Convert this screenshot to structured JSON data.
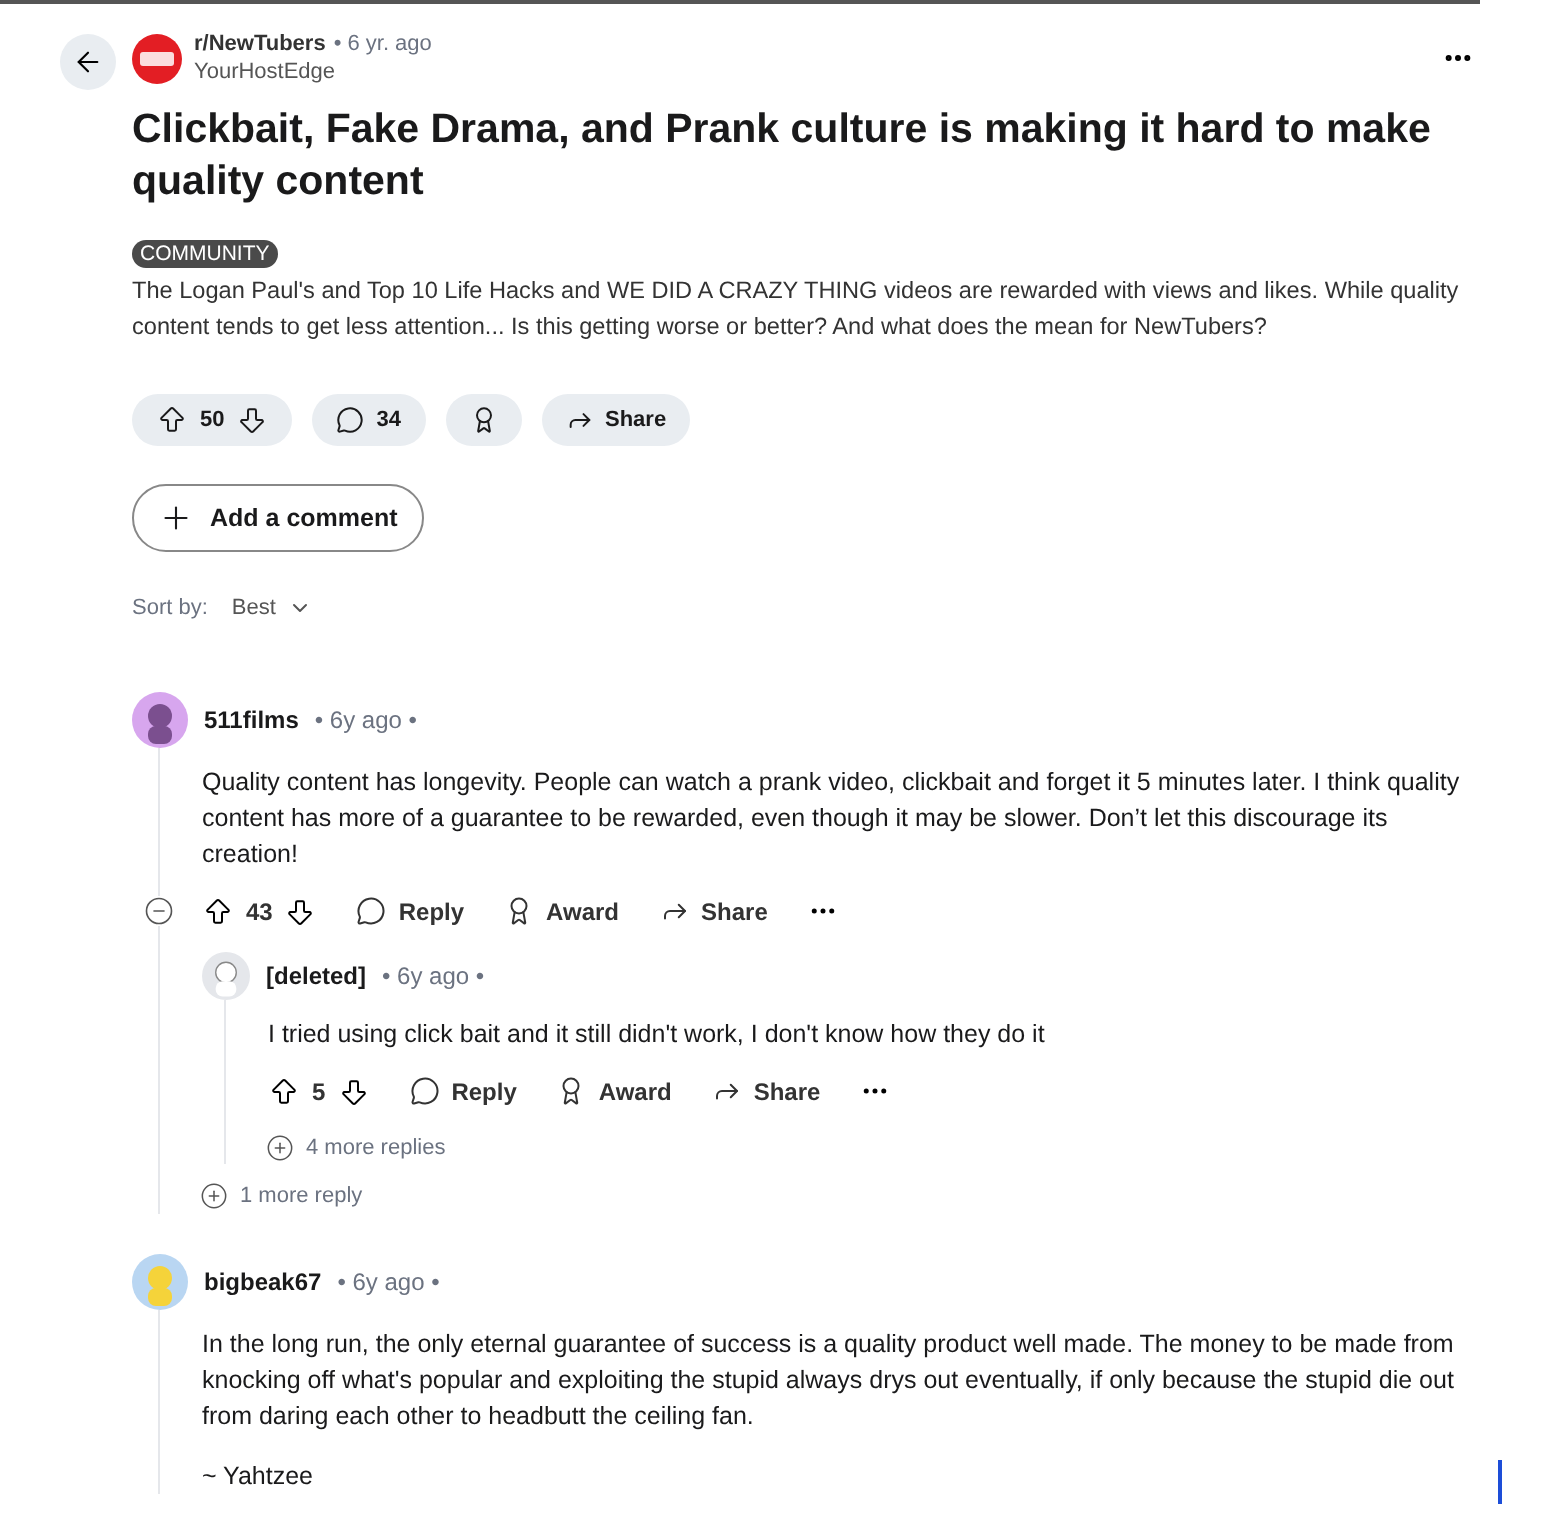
{
  "post": {
    "subreddit": "r/NewTubers",
    "age": "• 6 yr. ago",
    "author": "YourHostEdge",
    "title": "Clickbait, Fake Drama, and Prank culture is making it hard to make quality content",
    "flair": "COMMUNITY",
    "body": "The Logan Paul's and Top 10 Life Hacks and WE DID A CRAZY THING videos are rewarded with views and likes. While quality content tends to get less attention... Is this getting worse or better? And what does the mean for NewTubers?",
    "votes": "50",
    "comments": "34",
    "share": "Share",
    "add_comment": "Add a comment",
    "sort_label": "Sort by:",
    "sort_value": "Best"
  },
  "comments": [
    {
      "author": "511films",
      "age": "• 6y ago •",
      "body": [
        "Quality content has longevity. People can watch a prank video, clickbait and forget it 5 minutes later. I think quality content has more of a guarantee to be rewarded, even though it may be slower. Don’t let this discourage its creation!"
      ],
      "votes": "43",
      "reply": "Reply",
      "award": "Award",
      "share": "Share",
      "more": "1 more reply",
      "children": [
        {
          "author": "[deleted]",
          "age": "• 6y ago •",
          "body": [
            "I tried using click bait and it still didn't work, I don't know how they do it"
          ],
          "votes": "5",
          "reply": "Reply",
          "award": "Award",
          "share": "Share",
          "more": "4 more replies"
        }
      ]
    },
    {
      "author": "bigbeak67",
      "age": "• 6y ago •",
      "body": [
        "In the long run, the only eternal guarantee of success is a quality product well made. The money to be made from knocking off what's popular and exploiting the stupid always drys out eventually, if only because the stupid die out from daring each other to headbutt the ceiling fan.",
        "~ Yahtzee"
      ]
    }
  ]
}
